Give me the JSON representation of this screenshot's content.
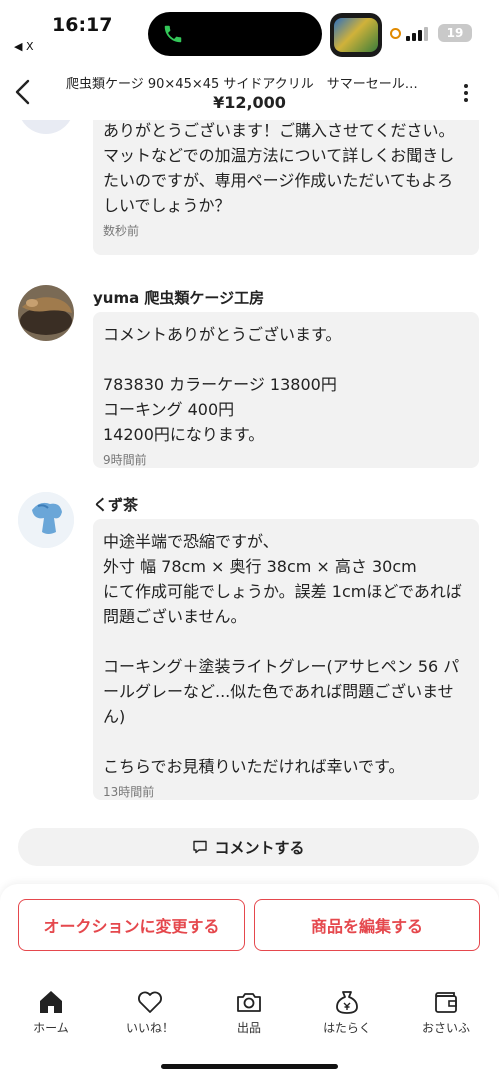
{
  "status_bar": {
    "time": "16:17",
    "back_app": "◀ X",
    "battery": "19"
  },
  "header": {
    "title": "爬虫類ケージ 90×45×45 サイドアクリル　サマーセール…",
    "price": "¥12,000"
  },
  "comments": [
    {
      "text": "ありがとうございます！ご購入させてください。\nマットなどでの加温方法について詳しくお聞きしたいのですが、専用ページ作成いただいてもよろしいでしょうか？",
      "time": "数秒前"
    },
    {
      "name": "yuma 爬虫類ケージ工房",
      "text": "コメントありがとうございます。\n\n783830 カラーケージ 13800円\nコーキング 400円\n14200円になります。",
      "time": "9時間前"
    },
    {
      "name": "くず茶",
      "text": "中途半端で恐縮ですが、\n外寸 幅 78cm × 奥行 38cm × 高さ 30cm\nにて作成可能でしょうか。誤差 1cmほどであれば問題ございません。\n\nコーキング＋塗装ライトグレー(アサヒペン 56 パールグレーなど...似た色であれば問題ございません)\n\nこちらでお見積りいただければ幸いです。",
      "time": "13時間前"
    }
  ],
  "comment_button": "コメントする",
  "actions": {
    "auction": "オークションに変更する",
    "edit": "商品を編集する"
  },
  "tabs": [
    {
      "label": "ホーム",
      "icon": "home-icon"
    },
    {
      "label": "いいね！",
      "icon": "heart-icon"
    },
    {
      "label": "出品",
      "icon": "camera-icon"
    },
    {
      "label": "はたらく",
      "icon": "money-bag-icon"
    },
    {
      "label": "おさいふ",
      "icon": "wallet-icon"
    }
  ],
  "colors": {
    "accent": "#e5484d",
    "bubble": "#f2f2f2"
  }
}
